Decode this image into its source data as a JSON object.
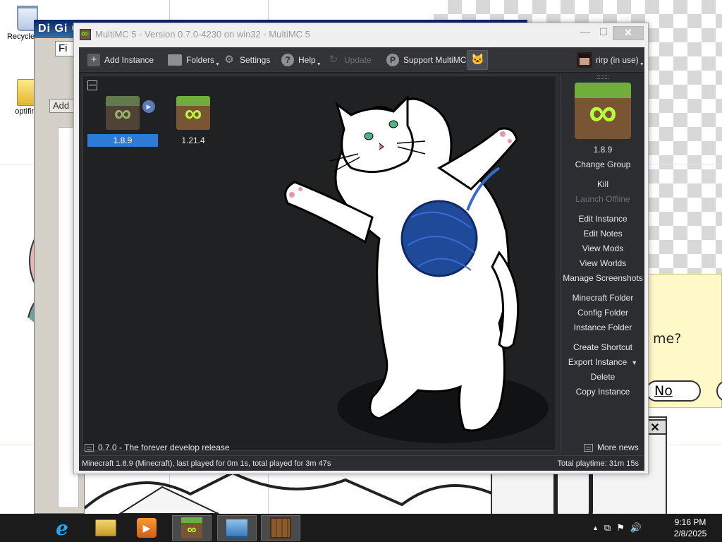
{
  "desktop": {
    "icons": [
      {
        "label": "Recycle Bin"
      },
      {
        "label": "optifine"
      }
    ],
    "background_window": {
      "title": "Di Gi C",
      "menu": "Fi",
      "add_button": "Add"
    },
    "dialog": {
      "question_fragment": "me?",
      "no_button": "No",
      "close_glyph": "✕"
    }
  },
  "window": {
    "title": "MultiMC 5 - Version 0.7.0-4230 on win32 - MultiMC 5",
    "controls": {
      "minimize": "—",
      "maximize": "☐",
      "close": "✕"
    }
  },
  "toolbar": {
    "add_instance": "Add Instance",
    "folders": "Folders",
    "settings": "Settings",
    "help": "Help",
    "update": "Update",
    "support": "Support MultiMC",
    "account": "rirp (in use)"
  },
  "instances": [
    {
      "name": "1.8.9",
      "selected": true,
      "running": true
    },
    {
      "name": "1.21.4",
      "selected": false,
      "running": false
    }
  ],
  "sidebar": {
    "instance_name": "1.8.9",
    "change_group": "Change Group",
    "kill": "Kill",
    "launch_offline": "Launch Offline",
    "edit_instance": "Edit Instance",
    "edit_notes": "Edit Notes",
    "view_mods": "View Mods",
    "view_worlds": "View Worlds",
    "manage_screenshots": "Manage Screenshots",
    "minecraft_folder": "Minecraft Folder",
    "config_folder": "Config Folder",
    "instance_folder": "Instance Folder",
    "create_shortcut": "Create Shortcut",
    "export_instance": "Export Instance",
    "delete": "Delete",
    "copy_instance": "Copy Instance"
  },
  "news": {
    "latest": "0.7.0 - The forever develop release",
    "more": "More news"
  },
  "status": {
    "left": "Minecraft 1.8.9 (Minecraft), last played for 0m 1s, total played for 3m 47s",
    "right": "Total playtime: 31m 15s"
  },
  "taskbar": {
    "apps": [
      "internet-explorer",
      "file-explorer",
      "media-player",
      "multimc",
      "remote-desktop",
      "minecraft-crafting-table"
    ],
    "clock_time": "9:16 PM",
    "clock_date": "2/8/2025"
  },
  "colors": {
    "window_bg": "#2b2d30",
    "selection": "#2e7bd6",
    "grass": "#6fae3a",
    "dirt": "#7a5534",
    "yarn": "#1f4a9a"
  }
}
